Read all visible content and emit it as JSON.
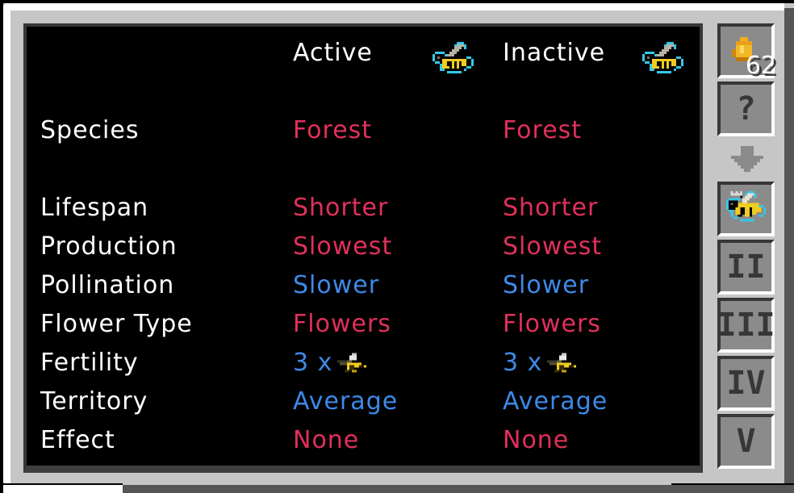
{
  "header": {
    "active_label": "Active",
    "inactive_label": "Inactive",
    "active_icon": "bee-icon",
    "inactive_icon": "bee-icon"
  },
  "rows": [
    {
      "label": "Species",
      "active": "Forest",
      "inactive": "Forest",
      "color": "red"
    },
    {
      "label": "Lifespan",
      "active": "Shorter",
      "inactive": "Shorter",
      "color": "red"
    },
    {
      "label": "Production",
      "active": "Slowest",
      "inactive": "Slowest",
      "color": "red"
    },
    {
      "label": "Pollination",
      "active": "Slower",
      "inactive": "Slower",
      "color": "blue"
    },
    {
      "label": "Flower Type",
      "active": "Flowers",
      "inactive": "Flowers",
      "color": "red"
    },
    {
      "label": "Fertility",
      "active": "3 x",
      "inactive": "3 x",
      "color": "blue",
      "icon": "drone-bee-icon"
    },
    {
      "label": "Territory",
      "active": "Average",
      "inactive": "Average",
      "color": "blue"
    },
    {
      "label": "Effect",
      "active": "None",
      "inactive": "None",
      "color": "red"
    }
  ],
  "colors": {
    "dominant": "#e0305a",
    "recessive": "#3d8ae8",
    "label": "#ffffff",
    "panel_bg": "#000000",
    "gui_bg": "#c6c6c6"
  },
  "sidebar": {
    "honey_drop_count": "62",
    "honey_drop_icon": "honey-drop-icon",
    "help_label": "?",
    "arrow_icon": "arrow-down-icon",
    "bee_slot_icon": "princess-bee-icon",
    "tabs": [
      {
        "label": "II"
      },
      {
        "label": "III"
      },
      {
        "label": "IV"
      },
      {
        "label": "V"
      }
    ]
  }
}
